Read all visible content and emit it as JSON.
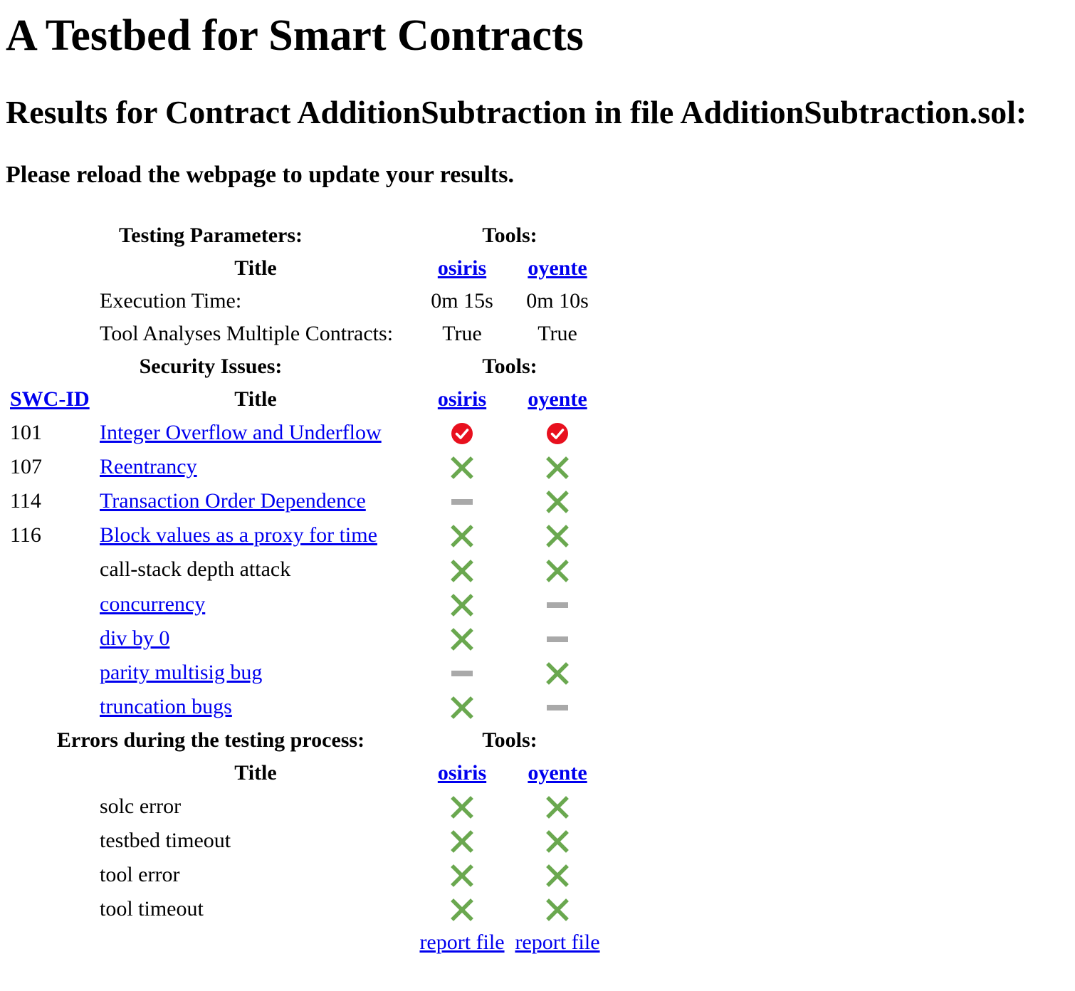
{
  "page": {
    "title": "A Testbed for Smart Contracts",
    "subtitle": "Results for Contract AdditionSubtraction in file AdditionSubtraction.sol:",
    "notice": "Please reload the webpage to update your results."
  },
  "colors": {
    "link": "#0000ee",
    "check_red": "#e8101e",
    "cross_green": "#6aa84f",
    "dash_gray": "#a9a9a9"
  },
  "testing_parameters": {
    "heading": "Testing Parameters:",
    "tools_heading": "Tools:",
    "title_header": "Title",
    "tools": [
      "osiris",
      "oyente"
    ],
    "rows": [
      {
        "label": "Execution Time:",
        "values": [
          "0m 15s",
          "0m 10s"
        ]
      },
      {
        "label": "Tool Analyses Multiple Contracts:",
        "values": [
          "True",
          "True"
        ]
      }
    ]
  },
  "security_issues": {
    "heading": "Security Issues:",
    "tools_heading": "Tools:",
    "swc_header": "SWC-ID",
    "title_header": "Title",
    "tools": [
      "osiris",
      "oyente"
    ],
    "rows": [
      {
        "swc": "101",
        "title": "Integer Overflow and Underflow",
        "link": true,
        "results": [
          "check-icon",
          "check-icon"
        ]
      },
      {
        "swc": "107",
        "title": "Reentrancy",
        "link": true,
        "results": [
          "cross-icon",
          "cross-icon"
        ]
      },
      {
        "swc": "114",
        "title": "Transaction Order Dependence",
        "link": true,
        "results": [
          "dash-icon",
          "cross-icon"
        ]
      },
      {
        "swc": "116",
        "title": "Block values as a proxy for time",
        "link": true,
        "results": [
          "cross-icon",
          "cross-icon"
        ]
      },
      {
        "swc": "",
        "title": "call-stack depth attack",
        "link": false,
        "results": [
          "cross-icon",
          "cross-icon"
        ]
      },
      {
        "swc": "",
        "title": "concurrency",
        "link": true,
        "results": [
          "cross-icon",
          "dash-icon"
        ]
      },
      {
        "swc": "",
        "title": "div by 0",
        "link": true,
        "results": [
          "cross-icon",
          "dash-icon"
        ]
      },
      {
        "swc": "",
        "title": "parity multisig bug",
        "link": true,
        "results": [
          "dash-icon",
          "cross-icon"
        ]
      },
      {
        "swc": "",
        "title": "truncation bugs",
        "link": true,
        "results": [
          "cross-icon",
          "dash-icon"
        ]
      }
    ]
  },
  "errors": {
    "heading": "Errors during the testing process:",
    "tools_heading": "Tools:",
    "title_header": "Title",
    "tools": [
      "osiris",
      "oyente"
    ],
    "rows": [
      {
        "title": "solc error",
        "results": [
          "cross-icon",
          "cross-icon"
        ]
      },
      {
        "title": "testbed timeout",
        "results": [
          "cross-icon",
          "cross-icon"
        ]
      },
      {
        "title": "tool error",
        "results": [
          "cross-icon",
          "cross-icon"
        ]
      },
      {
        "title": "tool timeout",
        "results": [
          "cross-icon",
          "cross-icon"
        ]
      }
    ],
    "report_links": [
      "report file",
      "report file"
    ]
  }
}
